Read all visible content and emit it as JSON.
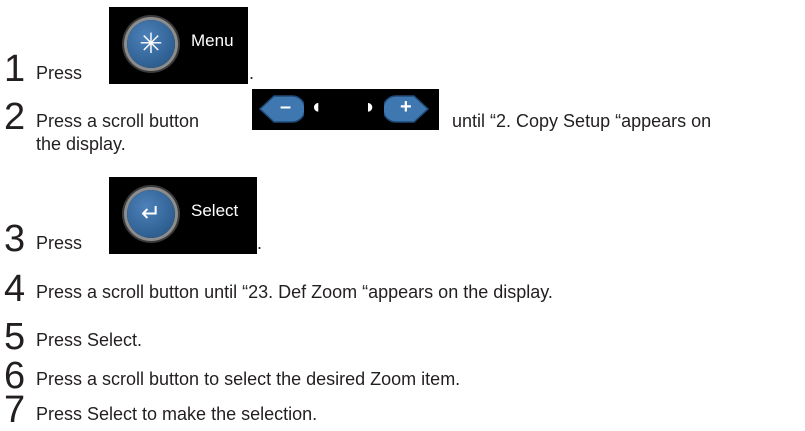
{
  "steps": [
    {
      "num": "1",
      "pre": "Press",
      "post": "."
    },
    {
      "num": "2",
      "pre": "Press a scroll button",
      "post": "until “2. Copy Setup “appears on",
      "line2": "the display."
    },
    {
      "num": "3",
      "pre": "Press",
      "post": "."
    },
    {
      "num": "4",
      "text": "Press a scroll button until “23. Def Zoom “appears on the display."
    },
    {
      "num": "5",
      "text": "Press Select."
    },
    {
      "num": "6",
      "text": "Press a scroll button to select the desired Zoom item."
    },
    {
      "num": "7",
      "text": "Press Select to make the selection."
    }
  ],
  "buttons": {
    "menu_label": "Menu",
    "menu_symbol": "✳",
    "select_label": "Select",
    "select_symbol": "↵",
    "minus_symbol": "–",
    "plus_symbol": "+",
    "left_glyph": "◖",
    "right_glyph": "◗"
  },
  "colors": {
    "button_blue": "#3a6ea5",
    "panel_bg": "#000000",
    "text": "#231f20"
  }
}
